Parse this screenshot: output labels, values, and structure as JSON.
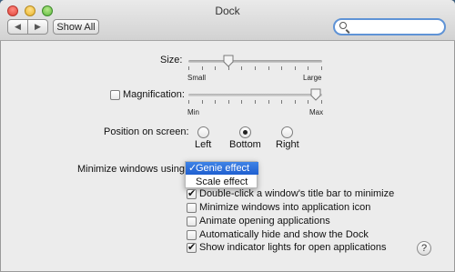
{
  "window": {
    "title": "Dock"
  },
  "toolbar": {
    "back": "◀",
    "forward": "▶",
    "show_all_label": "Show All"
  },
  "search": {
    "value": "",
    "placeholder": ""
  },
  "size": {
    "label": "Size:",
    "min_label": "Small",
    "max_label": "Large",
    "value_fraction": 0.3
  },
  "magnification": {
    "label": "Magnification:",
    "checked": false,
    "min_label": "Min",
    "max_label": "Max",
    "value_fraction": 0.95
  },
  "position": {
    "label": "Position on screen:",
    "options": [
      {
        "label": "Left",
        "selected": false
      },
      {
        "label": "Bottom",
        "selected": true
      },
      {
        "label": "Right",
        "selected": false
      }
    ]
  },
  "minimize": {
    "label": "Minimize windows using",
    "menu": [
      {
        "label": "Genie effect",
        "selected": true,
        "check": "✓"
      },
      {
        "label": "Scale effect",
        "selected": false,
        "check": ""
      }
    ]
  },
  "options": [
    {
      "label": "Double-click a window's title bar to minimize",
      "checked": true
    },
    {
      "label": "Minimize windows into application icon",
      "checked": false
    },
    {
      "label": "Animate opening applications",
      "checked": false
    },
    {
      "label": "Automatically hide and show the Dock",
      "checked": false
    },
    {
      "label": "Show indicator lights for open applications",
      "checked": true
    }
  ],
  "help": {
    "label": "?"
  }
}
